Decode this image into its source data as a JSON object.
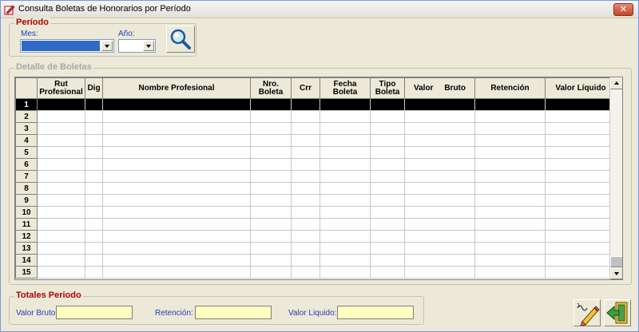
{
  "window": {
    "title": "Consulta Boletas de Honorarios por Período",
    "close_label": "✕"
  },
  "periodo": {
    "label": "Período",
    "mes_label": "Mes:",
    "anio_label": "Año:",
    "mes_value": "",
    "anio_value": ""
  },
  "detalle": {
    "label": "Detalle de Boletas",
    "columns": [
      "",
      "Rut Profesional",
      "Dig",
      "Nombre Profesional",
      "Nro. Boleta",
      "Crr",
      "Fecha Boleta",
      "Tipo Boleta",
      "Valor     Bruto",
      "Retención",
      "Valor Líquido"
    ],
    "rows": [
      "1",
      "2",
      "3",
      "4",
      "5",
      "6",
      "7",
      "8",
      "9",
      "10",
      "11",
      "12",
      "13",
      "14",
      "15"
    ],
    "selected_row": "1"
  },
  "totales": {
    "label": "Totales Periodo",
    "valor_bruto_label": "Valor Bruto:",
    "retencion_label": "Retención:",
    "valor_liquido_label": "Valor Liquido:",
    "valor_bruto": "",
    "retencion": "",
    "valor_liquido": ""
  },
  "colors": {
    "accent": "#3169c6",
    "group_title": "#b40000",
    "field_label": "#1f3fb4",
    "total_field": "#ffffc0"
  },
  "icons": [
    "app-icon",
    "close-icon",
    "search-icon",
    "edit-icon",
    "exit-icon"
  ]
}
